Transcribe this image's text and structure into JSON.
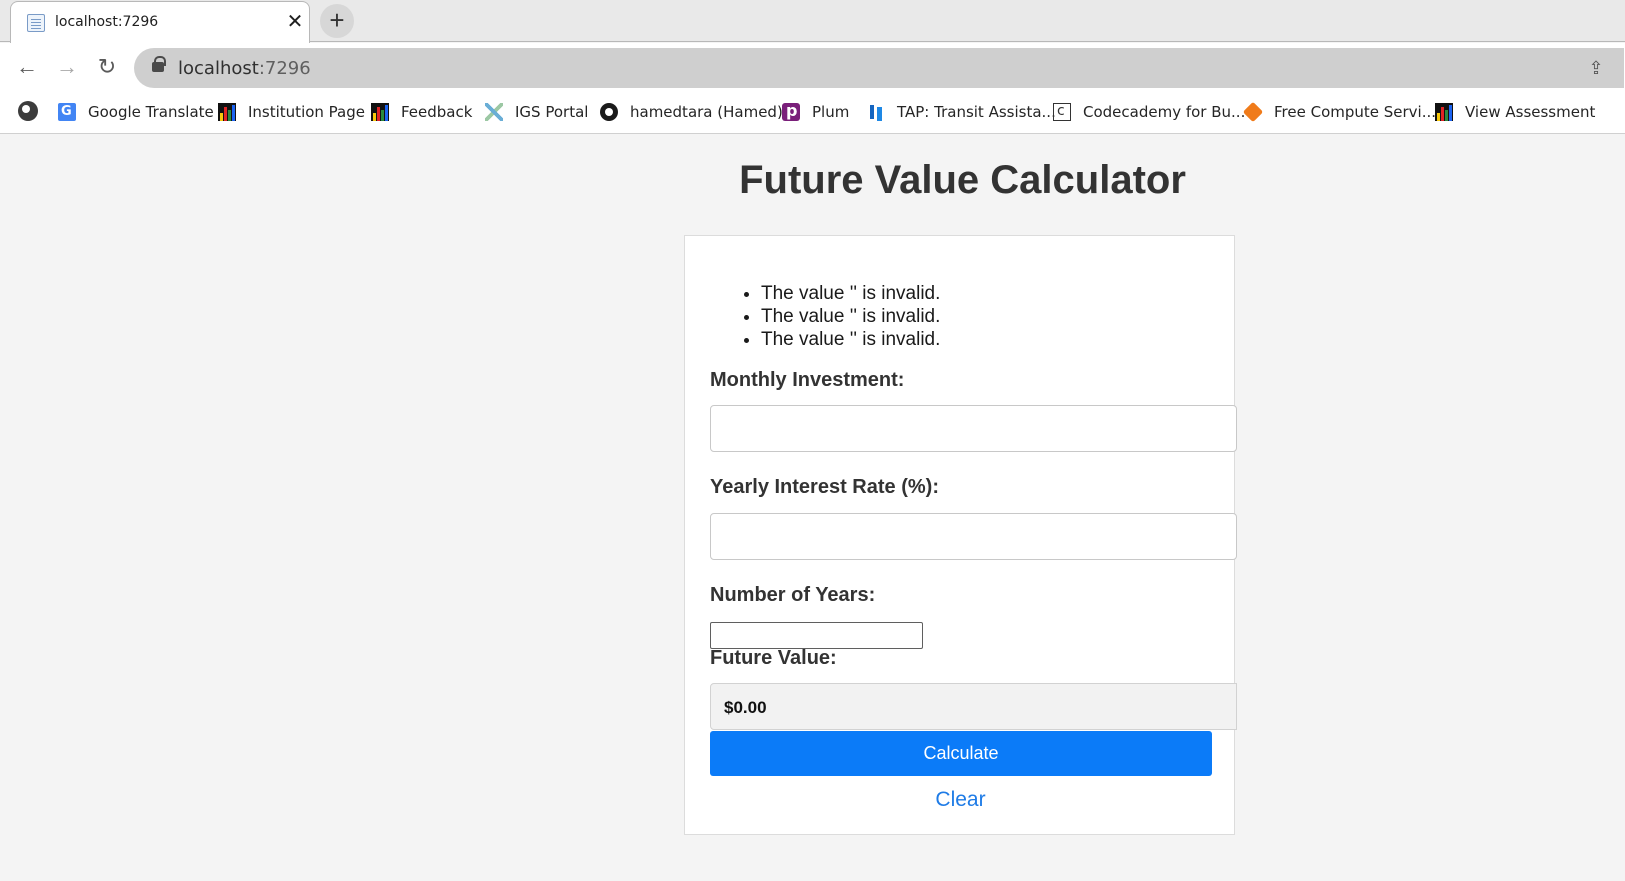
{
  "browser": {
    "tab_title": "localhost:7296",
    "url_host": "localhost",
    "url_port": ":7296",
    "bookmarks": [
      {
        "label": "Google Translate",
        "icon": "google-translate-icon"
      },
      {
        "label": "Institution Page",
        "icon": "bar-chart-icon"
      },
      {
        "label": "Feedback",
        "icon": "bar-chart-icon"
      },
      {
        "label": "IGS Portal",
        "icon": "igs-icon"
      },
      {
        "label": "hamedtara (Hamed)",
        "icon": "github-icon"
      },
      {
        "label": "Plum",
        "icon": "plum-icon"
      },
      {
        "label": "TAP: Transit Assista...",
        "icon": "tap-icon"
      },
      {
        "label": "Codecademy for Bu...",
        "icon": "codecademy-icon"
      },
      {
        "label": "Free Compute Servi...",
        "icon": "cube-icon"
      },
      {
        "label": "View Assessment",
        "icon": "bar-chart-icon"
      }
    ]
  },
  "page": {
    "title": "Future Value Calculator",
    "errors": [
      "The value '' is invalid.",
      "The value '' is invalid.",
      "The value '' is invalid."
    ],
    "fields": {
      "monthly_investment": {
        "label": "Monthly Investment:",
        "value": ""
      },
      "yearly_interest": {
        "label": "Yearly Interest Rate (%):",
        "value": ""
      },
      "years": {
        "label": "Number of Years:",
        "value": ""
      },
      "future_value": {
        "label": "Future Value:",
        "value": "$0.00"
      }
    },
    "calculate_label": "Calculate",
    "clear_label": "Clear"
  },
  "colors": {
    "primary_button": "#0b7bf8",
    "link": "#1e7be6",
    "page_background": "#f4f4f4"
  }
}
